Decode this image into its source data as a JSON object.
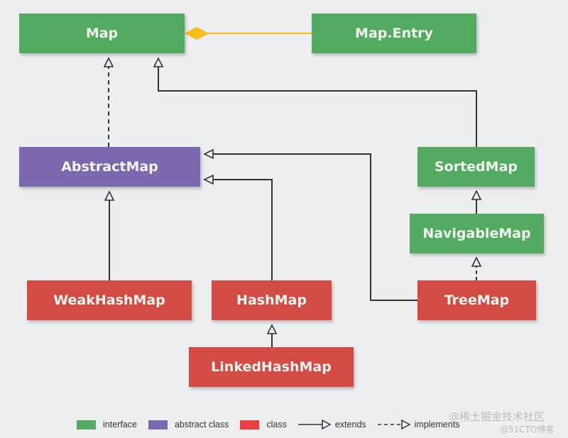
{
  "diagram": {
    "nodes": [
      {
        "id": "map",
        "label": "Map",
        "kind": "interface"
      },
      {
        "id": "map-entry",
        "label": "Map.Entry",
        "kind": "interface"
      },
      {
        "id": "abstract-map",
        "label": "AbstractMap",
        "kind": "abstract class"
      },
      {
        "id": "sorted-map",
        "label": "SortedMap",
        "kind": "interface"
      },
      {
        "id": "navigable-map",
        "label": "NavigableMap",
        "kind": "interface"
      },
      {
        "id": "weak-hash-map",
        "label": "WeakHashMap",
        "kind": "class"
      },
      {
        "id": "hash-map",
        "label": "HashMap",
        "kind": "class"
      },
      {
        "id": "tree-map",
        "label": "TreeMap",
        "kind": "class"
      },
      {
        "id": "linked-hash-map",
        "label": "LinkedHashMap",
        "kind": "class"
      }
    ],
    "edges": [
      {
        "from": "Map",
        "to": "Map.Entry",
        "type": "composition"
      },
      {
        "from": "AbstractMap",
        "to": "Map",
        "type": "implements"
      },
      {
        "from": "SortedMap",
        "to": "Map",
        "type": "extends"
      },
      {
        "from": "NavigableMap",
        "to": "SortedMap",
        "type": "extends"
      },
      {
        "from": "TreeMap",
        "to": "NavigableMap",
        "type": "implements"
      },
      {
        "from": "TreeMap",
        "to": "AbstractMap",
        "type": "extends"
      },
      {
        "from": "HashMap",
        "to": "AbstractMap",
        "type": "extends"
      },
      {
        "from": "WeakHashMap",
        "to": "AbstractMap",
        "type": "extends"
      },
      {
        "from": "LinkedHashMap",
        "to": "HashMap",
        "type": "extends"
      }
    ],
    "colors": {
      "interface": "#52ab60",
      "abstract_class": "#7b68ae",
      "class": "#d44b45",
      "composition": "#f5bf16",
      "line": "#2f3336"
    }
  },
  "legend": {
    "interface": "interface",
    "abstract_class": "abstract class",
    "class": "class",
    "extends": "extends",
    "implements": "implements"
  },
  "watermarks": [
    "@稀土掘金技术社区",
    "@51CTO博客"
  ]
}
